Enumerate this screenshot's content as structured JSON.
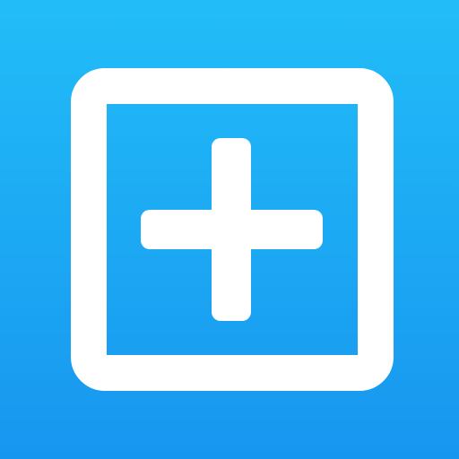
{
  "app_icon": {
    "icon_name": "add-square-icon",
    "background_gradient": {
      "top_color": "#22BDF8",
      "bottom_color": "#1796EF"
    },
    "frame_color": "#FFFFFF",
    "plus_color": "#FFFFFF"
  }
}
